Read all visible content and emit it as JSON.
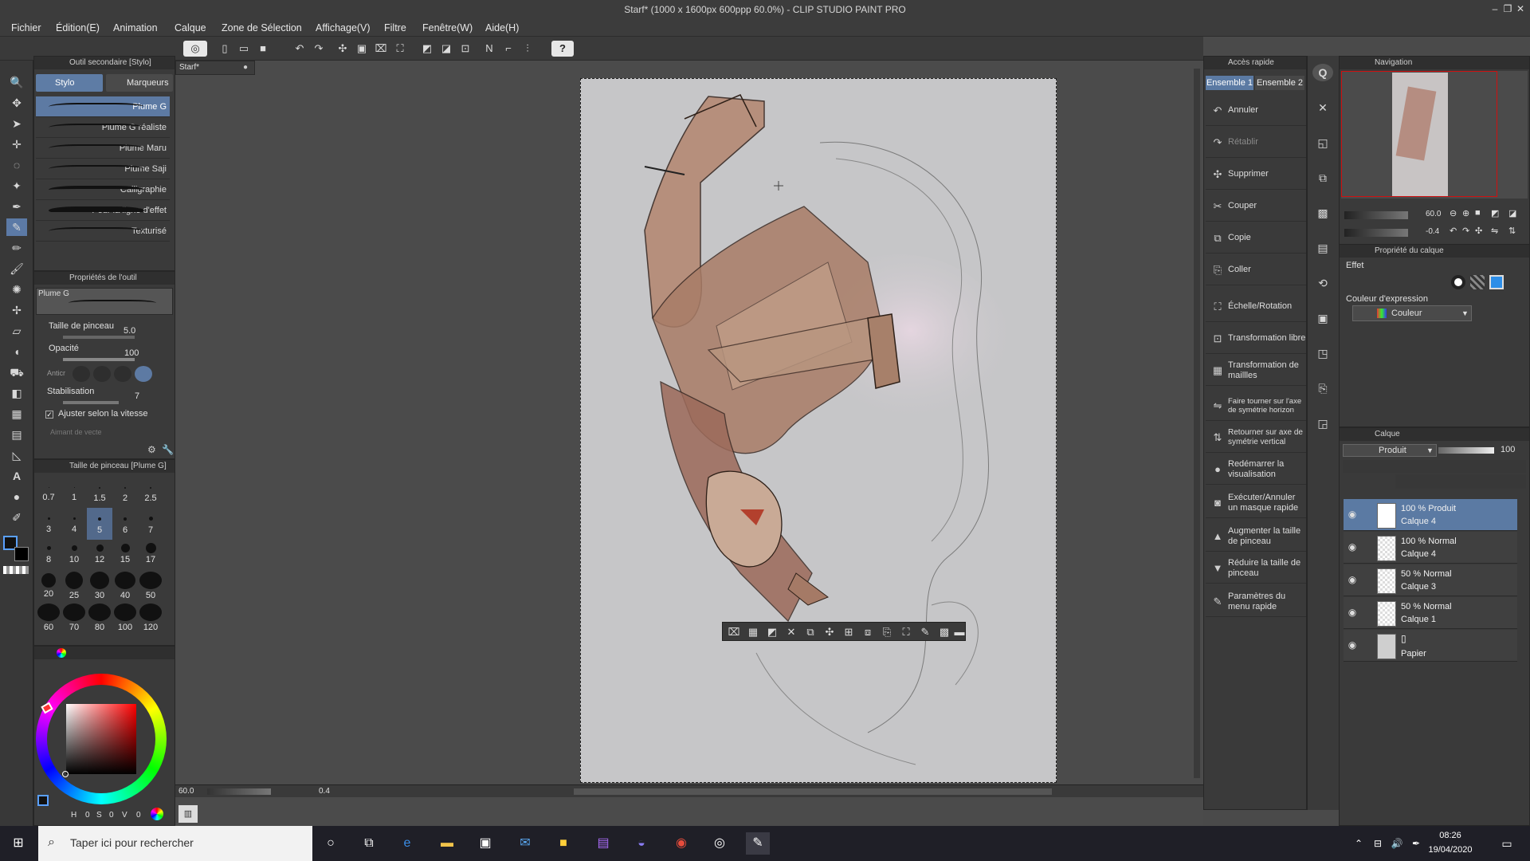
{
  "window": {
    "title": "Starf* (1000 x 1600px 600ppp 60.0%) - CLIP STUDIO PAINT PRO",
    "minimize": "‒",
    "maximize": "❐",
    "close": "✕"
  },
  "menu": [
    "Fichier",
    "Édition(E)",
    "Animation",
    "Calque",
    "Zone de Sélection",
    "Affichage(V)",
    "Filtre",
    "Fenêtre(W)",
    "Aide(H)"
  ],
  "subtool": {
    "panel_title": "Outil secondaire [Stylo]",
    "tabs": [
      "Stylo",
      "Marqueurs"
    ],
    "brushes": [
      "Plume G",
      "Plume G réaliste",
      "Plume Maru",
      "Plume Saji",
      "Calligraphie",
      "Pour la ligne d'effet",
      "Texturisé"
    ]
  },
  "tool_props": {
    "panel_title": "Propriétés de l'outil",
    "brush_name": "Plume G",
    "brush_size_label": "Taille de pinceau",
    "brush_size_value": "5.0",
    "opacity_label": "Opacité",
    "opacity_value": "100",
    "antialias_label": "Anticr",
    "stabilization_label": "Stabilisation",
    "stabilization_value": "7",
    "speed_adjust_label": "Ajuster selon la vitesse",
    "vector_label": "Aimant de vecte"
  },
  "brush_size_panel": {
    "title": "Taille de pinceau [Plume G]",
    "sizes": [
      "0.7",
      "1",
      "1.5",
      "2",
      "2.5",
      "3",
      "4",
      "5",
      "6",
      "7",
      "8",
      "10",
      "12",
      "15",
      "17",
      "20",
      "25",
      "30",
      "40",
      "50",
      "60",
      "70",
      "80",
      "100",
      "120"
    ],
    "active": "5"
  },
  "color_wheel": {
    "h_label": "H",
    "h_value": "0",
    "s_label": "S",
    "s_value": "0",
    "v_label": "V",
    "v_value": "0"
  },
  "canvas": {
    "tab_label": "Starf*",
    "zoom_value": "60.0",
    "angle_value": "0.4"
  },
  "quick_access": {
    "title": "Accès rapide",
    "tabs": [
      "Ensemble 1",
      "Ensemble 2"
    ],
    "items": [
      {
        "label": "Annuler",
        "icon": "undo-icon",
        "enabled": true
      },
      {
        "label": "Rétablir",
        "icon": "redo-icon",
        "enabled": false
      },
      {
        "label": "Supprimer",
        "icon": "delete-icon",
        "enabled": true
      },
      {
        "label": "Couper",
        "icon": "cut-icon",
        "enabled": true
      },
      {
        "label": "Copie",
        "icon": "copy-icon",
        "enabled": true
      },
      {
        "label": "Coller",
        "icon": "paste-icon",
        "enabled": true
      },
      {
        "label": "Échelle/Rotation",
        "icon": "scale-icon",
        "enabled": true
      },
      {
        "label": "Transformation libre",
        "icon": "free-transform-icon",
        "enabled": true
      },
      {
        "label": "Transformation de maillles",
        "icon": "mesh-transform-icon",
        "enabled": true
      },
      {
        "label": "Faire tourner sur l'axe de symétrie horizon",
        "icon": "flip-horizontal-icon",
        "enabled": true
      },
      {
        "label": "Retourner sur axe de symétrie vertical",
        "icon": "flip-vertical-icon",
        "enabled": true
      },
      {
        "label": "Redémarrer la visualisation",
        "icon": "reset-view-icon",
        "enabled": true
      },
      {
        "label": "Exécuter/Annuler un masque rapide",
        "icon": "quick-mask-icon",
        "enabled": true
      },
      {
        "label": "Augmenter la taille de pinceau",
        "icon": "increase-brush-icon",
        "enabled": true
      },
      {
        "label": "Réduire la taille de pinceau",
        "icon": "decrease-brush-icon",
        "enabled": true
      },
      {
        "label": "Paramètres du menu rapide",
        "icon": "settings-icon",
        "enabled": true
      }
    ]
  },
  "navigator": {
    "title": "Navigation",
    "zoom": "60.0",
    "angle": "-0.4"
  },
  "layer_props": {
    "title": "Propriété du calque",
    "effect_label": "Effet",
    "expression_label": "Couleur d'expression",
    "expression_value": "Couleur"
  },
  "layers": {
    "title": "Calque",
    "blend_mode": "Produit",
    "opacity": "100",
    "items": [
      {
        "mode": "100 % Produit",
        "name": "Calque 4",
        "active": true
      },
      {
        "mode": "100 % Normal",
        "name": "Calque 4",
        "active": false
      },
      {
        "mode": "50 % Normal",
        "name": "Calque 3",
        "active": false
      },
      {
        "mode": "50 % Normal",
        "name": "Calque 1",
        "active": false
      },
      {
        "mode": "",
        "name": "Papier",
        "active": false
      }
    ]
  },
  "taskbar": {
    "search_placeholder": "Taper ici pour rechercher",
    "time": "08:26",
    "date": "19/04/2020"
  }
}
